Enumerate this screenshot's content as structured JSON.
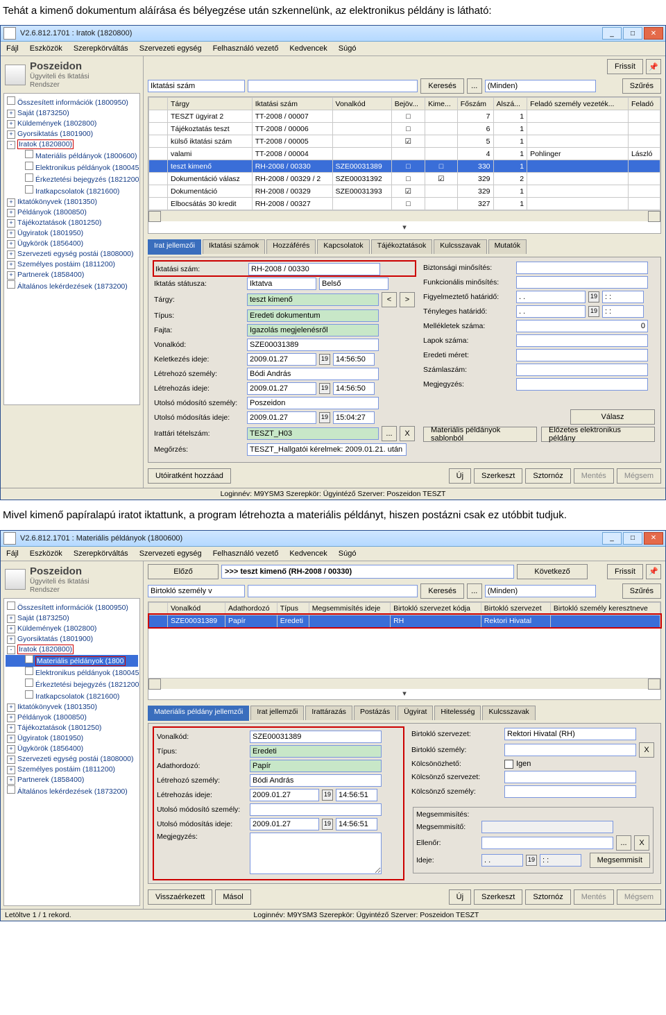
{
  "para1": "Tehát a kimenő dokumentum aláírása és bélyegzése után szkennelünk, az elektronikus példány is látható:",
  "para2": "Mivel kimenő papíralapú iratot iktattunk, a program létrehozta a materiális példányt, hiszen postázni csak ez utóbbit tudjuk.",
  "win1": {
    "title": "V2.6.812.1701 : Iratok (1820800)",
    "menu": [
      "Fájl",
      "Eszközök",
      "Szerepkörváltás",
      "Szervezeti egység",
      "Felhasználó vezető",
      "Kedvencek",
      "Súgó"
    ],
    "logo1": "Poszeidon",
    "logo2": "Ügyviteli és Iktatási",
    "logo3": "Rendszer",
    "frissit": "Frissít",
    "search_cat": "Iktatási szám",
    "search_btn": "Keresés",
    "dots": "...",
    "scope": "(Minden)",
    "szures": "Szűrés",
    "cols": [
      "Tárgy",
      "Iktatási szám",
      "Vonalkód",
      "Bejöv...",
      "Kime...",
      "Főszám",
      "Alszá...",
      "Feladó személy vezeték...",
      "Feladó"
    ],
    "rows": [
      {
        "t": "TESZT ügyirat 2",
        "ik": "TT-2008 / 00007",
        "vk": "",
        "b": "□",
        "k": "",
        "f": "7",
        "a": "1",
        "v1": "",
        "v2": ""
      },
      {
        "t": "Tájékoztatás teszt",
        "ik": "TT-2008 / 00006",
        "vk": "",
        "b": "□",
        "k": "",
        "f": "6",
        "a": "1",
        "v1": "",
        "v2": ""
      },
      {
        "t": "külső iktatási szám",
        "ik": "TT-2008 / 00005",
        "vk": "",
        "b": "☑",
        "k": "",
        "f": "5",
        "a": "1",
        "v1": "",
        "v2": ""
      },
      {
        "t": "valami",
        "ik": "TT-2008 / 00004",
        "vk": "",
        "b": "",
        "k": "",
        "f": "4",
        "a": "1",
        "v1": "Pohlinger",
        "v2": "László"
      },
      {
        "t": "teszt kimenő",
        "ik": "RH-2008 / 00330",
        "vk": "SZE00031389",
        "b": "□",
        "k": "□",
        "f": "330",
        "a": "1",
        "v1": "",
        "v2": "",
        "sel": true
      },
      {
        "t": "Dokumentáció válasz",
        "ik": "RH-2008 / 00329 / 2",
        "vk": "SZE00031392",
        "b": "□",
        "k": "☑",
        "f": "329",
        "a": "2",
        "v1": "",
        "v2": ""
      },
      {
        "t": "Dokumentáció",
        "ik": "RH-2008 / 00329",
        "vk": "SZE00031393",
        "b": "☑",
        "k": "",
        "f": "329",
        "a": "1",
        "v1": "",
        "v2": ""
      },
      {
        "t": "Elbocsátás 30 kredit",
        "ik": "RH-2008 / 00327",
        "vk": "",
        "b": "□",
        "k": "",
        "f": "327",
        "a": "1",
        "v1": "",
        "v2": ""
      }
    ],
    "tabs": [
      "Irat jellemzői",
      "Iktatási számok",
      "Hozzáférés",
      "Kapcsolatok",
      "Tájékoztatások",
      "Kulcsszavak",
      "Mutatók"
    ],
    "form": {
      "iktatasi_szam_l": "Iktatási szám:",
      "iktatasi_szam": "RH-2008 / 00330",
      "status_l": "Iktatás státusza:",
      "status": "Iktatva",
      "belso": "Belső",
      "targy_l": "Tárgy:",
      "targy": "teszt kimenő",
      "tipus_l": "Típus:",
      "tipus": "Eredeti dokumentum",
      "fajta_l": "Fajta:",
      "fajta": "Igazolás megjelenésről",
      "vonalkod_l": "Vonalkód:",
      "vonalkod": "SZE00031389",
      "keletk_l": "Keletkezés ideje:",
      "keletk_d": "2009.01.27",
      "keletk_t": "14:56:50",
      "letre_sz_l": "Létrehozó személy:",
      "letre_sz": "Bódi András",
      "letre_i_l": "Létrehozás ideje:",
      "letre_i_d": "2009.01.27",
      "letre_i_t": "14:56:50",
      "umod_sz_l": "Utolsó módosító személy:",
      "umod_sz": "Poszeidon",
      "umod_i_l": "Utolsó módosítás ideje:",
      "umod_i_d": "2009.01.27",
      "umod_i_t": "15:04:27",
      "irattar_l": "Irattári tételszám:",
      "irattar": "TESZT_H03",
      "megorzes_l": "Megőrzés:",
      "megorzes": "TESZT_Hallgatói kérelmek: 2009.01.21. után",
      "bizt_l": "Biztonsági minősítés:",
      "funk_l": "Funkcionális minősítés:",
      "figyh_l": "Figyelmeztető határidő:",
      "figyh": ". .",
      "tenyh_l": "Tényleges határidő:",
      "tenyh": ". .",
      "mell_l": "Mellékletek száma:",
      "mell": "0",
      "lap_l": "Lapok száma:",
      "eredm_l": "Eredeti méret:",
      "szamla_l": "Számlaszám:",
      "megj_l": "Megjegyzés:",
      "valasz": "Válasz",
      "matsab": "Materiális példányok sablonból",
      "elozetes": "Előzetes elektronikus példány"
    },
    "btns": {
      "utoirat": "Utóiratként hozzáad",
      "uj": "Új",
      "szerk": "Szerkeszt",
      "sztorn": "Sztornóz",
      "mentes": "Mentés",
      "megsem": "Mégsem"
    },
    "statusbar": "Loginnév: M9YSM3   Szerepkör: Ügyintéző   Szerver: Poszeidon TESZT"
  },
  "tree1": [
    {
      "l": "Összesített információk (1800950)",
      "p": ""
    },
    {
      "l": "Saját (1873250)",
      "p": "+"
    },
    {
      "l": "Küldemények (1802800)",
      "p": "+"
    },
    {
      "l": "Gyorsiktatás (1801900)",
      "p": "+"
    },
    {
      "l": "Iratok (1820800)",
      "p": "-",
      "box": true
    },
    {
      "l": "Materiális példányok (1800600)",
      "p": "",
      "in": 2
    },
    {
      "l": "Elektronikus példányok (180045",
      "p": "",
      "in": 2
    },
    {
      "l": "Érkeztetési bejegyzés (1821200)",
      "p": "",
      "in": 2
    },
    {
      "l": "Iratkapcsolatok (1821600)",
      "p": "",
      "in": 2
    },
    {
      "l": "Iktatókönyvek (1801350)",
      "p": "+"
    },
    {
      "l": "Példányok (1800850)",
      "p": "+"
    },
    {
      "l": "Tájékoztatások (1801250)",
      "p": "+"
    },
    {
      "l": "Ügyiratok (1801950)",
      "p": "+"
    },
    {
      "l": "Ügykörök (1856400)",
      "p": "+"
    },
    {
      "l": "Szervezeti egység postái (1808000)",
      "p": "+"
    },
    {
      "l": "Személyes postáim (1811200)",
      "p": "+"
    },
    {
      "l": "Partnerek (1858400)",
      "p": "+"
    },
    {
      "l": "Általános lekérdezések (1873200)",
      "p": ""
    }
  ],
  "win2": {
    "title": "V2.6.812.1701 : Materiális példányok (1800600)",
    "elozo": "Előző",
    "path": ">>> teszt kimenő (RH-2008 / 00330)",
    "kovetkezo": "Következő",
    "search_cat": "Birtokló személy v",
    "szures": "Szűrés",
    "frissit": "Frissít",
    "search_btn": "Keresés",
    "dots": "...",
    "scope": "(Minden)",
    "cols": [
      "Vonalkód",
      "Adathordozó",
      "Típus",
      "Megsemmisítés ideje",
      "Birtokló szervezet kódja",
      "Birtokló szervezet",
      "Birtokló személy keresztneve"
    ],
    "row": {
      "vk": "SZE00031389",
      "ah": "Papír",
      "t": "Eredeti",
      "msi": "",
      "bsk": "RH",
      "bs": "Rektori Hivatal",
      "bszk": ""
    },
    "tabs": [
      "Materiális példány jellemzői",
      "Irat jellemzői",
      "Irattárazás",
      "Postázás",
      "Ügyirat",
      "Hitelesség",
      "Kulcsszavak"
    ],
    "form": {
      "vonalkod_l": "Vonalkód:",
      "vonalkod": "SZE00031389",
      "tipus_l": "Típus:",
      "tipus": "Eredeti",
      "adath_l": "Adathordozó:",
      "adath": "Papír",
      "letre_sz_l": "Létrehozó személy:",
      "letre_sz": "Bódi András",
      "letre_i_l": "Létrehozás ideje:",
      "letre_i_d": "2009.01.27",
      "letre_i_t": "14:56:51",
      "umod_sz_l": "Utolsó módosító személy:",
      "umod_i_l": "Utolsó módosítás ideje:",
      "umod_i_d": "2009.01.27",
      "umod_i_t": "14:56:51",
      "megj_l": "Megjegyzés:",
      "birt_sz_l": "Birtokló szervezet:",
      "birt_sz": "Rektori Hivatal (RH)",
      "birt_p_l": "Birtokló személy:",
      "kolcs_l": "Kölcsönözhető:",
      "kolcs_v": "Igen",
      "kolcs_sz_l": "Kölcsönző szervezet:",
      "kolcs_p_l": "Kölcsönző személy:",
      "megse_l": "Megsemmisítés:",
      "megseito_l": "Megsemmisítő:",
      "ellenor_l": "Ellenőr:",
      "ideje_l": "Ideje:",
      "ideje_t": ": :",
      "ideje_d": ". .",
      "megse_btn": "Megsemmisít"
    },
    "btns": {
      "vissza": "Visszaérkezett",
      "masol": "Másol",
      "uj": "Új",
      "szerk": "Szerkeszt",
      "sztorn": "Sztornóz",
      "mentes": "Mentés",
      "megsem": "Mégsem"
    },
    "leftstatus": "Letöltve 1 / 1 rekord.",
    "statusbar": "Loginnév: M9YSM3   Szerepkör: Ügyintéző   Szerver: Poszeidon TESZT"
  },
  "tree2": [
    {
      "l": "Összesített információk (1800950)",
      "p": ""
    },
    {
      "l": "Saját (1873250)",
      "p": "+"
    },
    {
      "l": "Küldemények (1802800)",
      "p": "+"
    },
    {
      "l": "Gyorsiktatás (1801900)",
      "p": "+"
    },
    {
      "l": "Iratok (1820800)",
      "p": "-",
      "box": true
    },
    {
      "l": "Materiális példányok (1800",
      "p": "",
      "in": 2,
      "selblue": true,
      "box": true
    },
    {
      "l": "Elektronikus példányok (180045",
      "p": "",
      "in": 2
    },
    {
      "l": "Érkeztetési bejegyzés (1821200)",
      "p": "",
      "in": 2
    },
    {
      "l": "Iratkapcsolatok (1821600)",
      "p": "",
      "in": 2
    },
    {
      "l": "Iktatókönyvek (1801350)",
      "p": "+"
    },
    {
      "l": "Példányok (1800850)",
      "p": "+"
    },
    {
      "l": "Tájékoztatások (1801250)",
      "p": "+"
    },
    {
      "l": "Ügyiratok (1801950)",
      "p": "+"
    },
    {
      "l": "Ügykörök (1856400)",
      "p": "+"
    },
    {
      "l": "Szervezeti egység postái (1808000)",
      "p": "+"
    },
    {
      "l": "Személyes postáim (1811200)",
      "p": "+"
    },
    {
      "l": "Partnerek (1858400)",
      "p": "+"
    },
    {
      "l": "Általános lekérdezések (1873200)",
      "p": ""
    }
  ]
}
